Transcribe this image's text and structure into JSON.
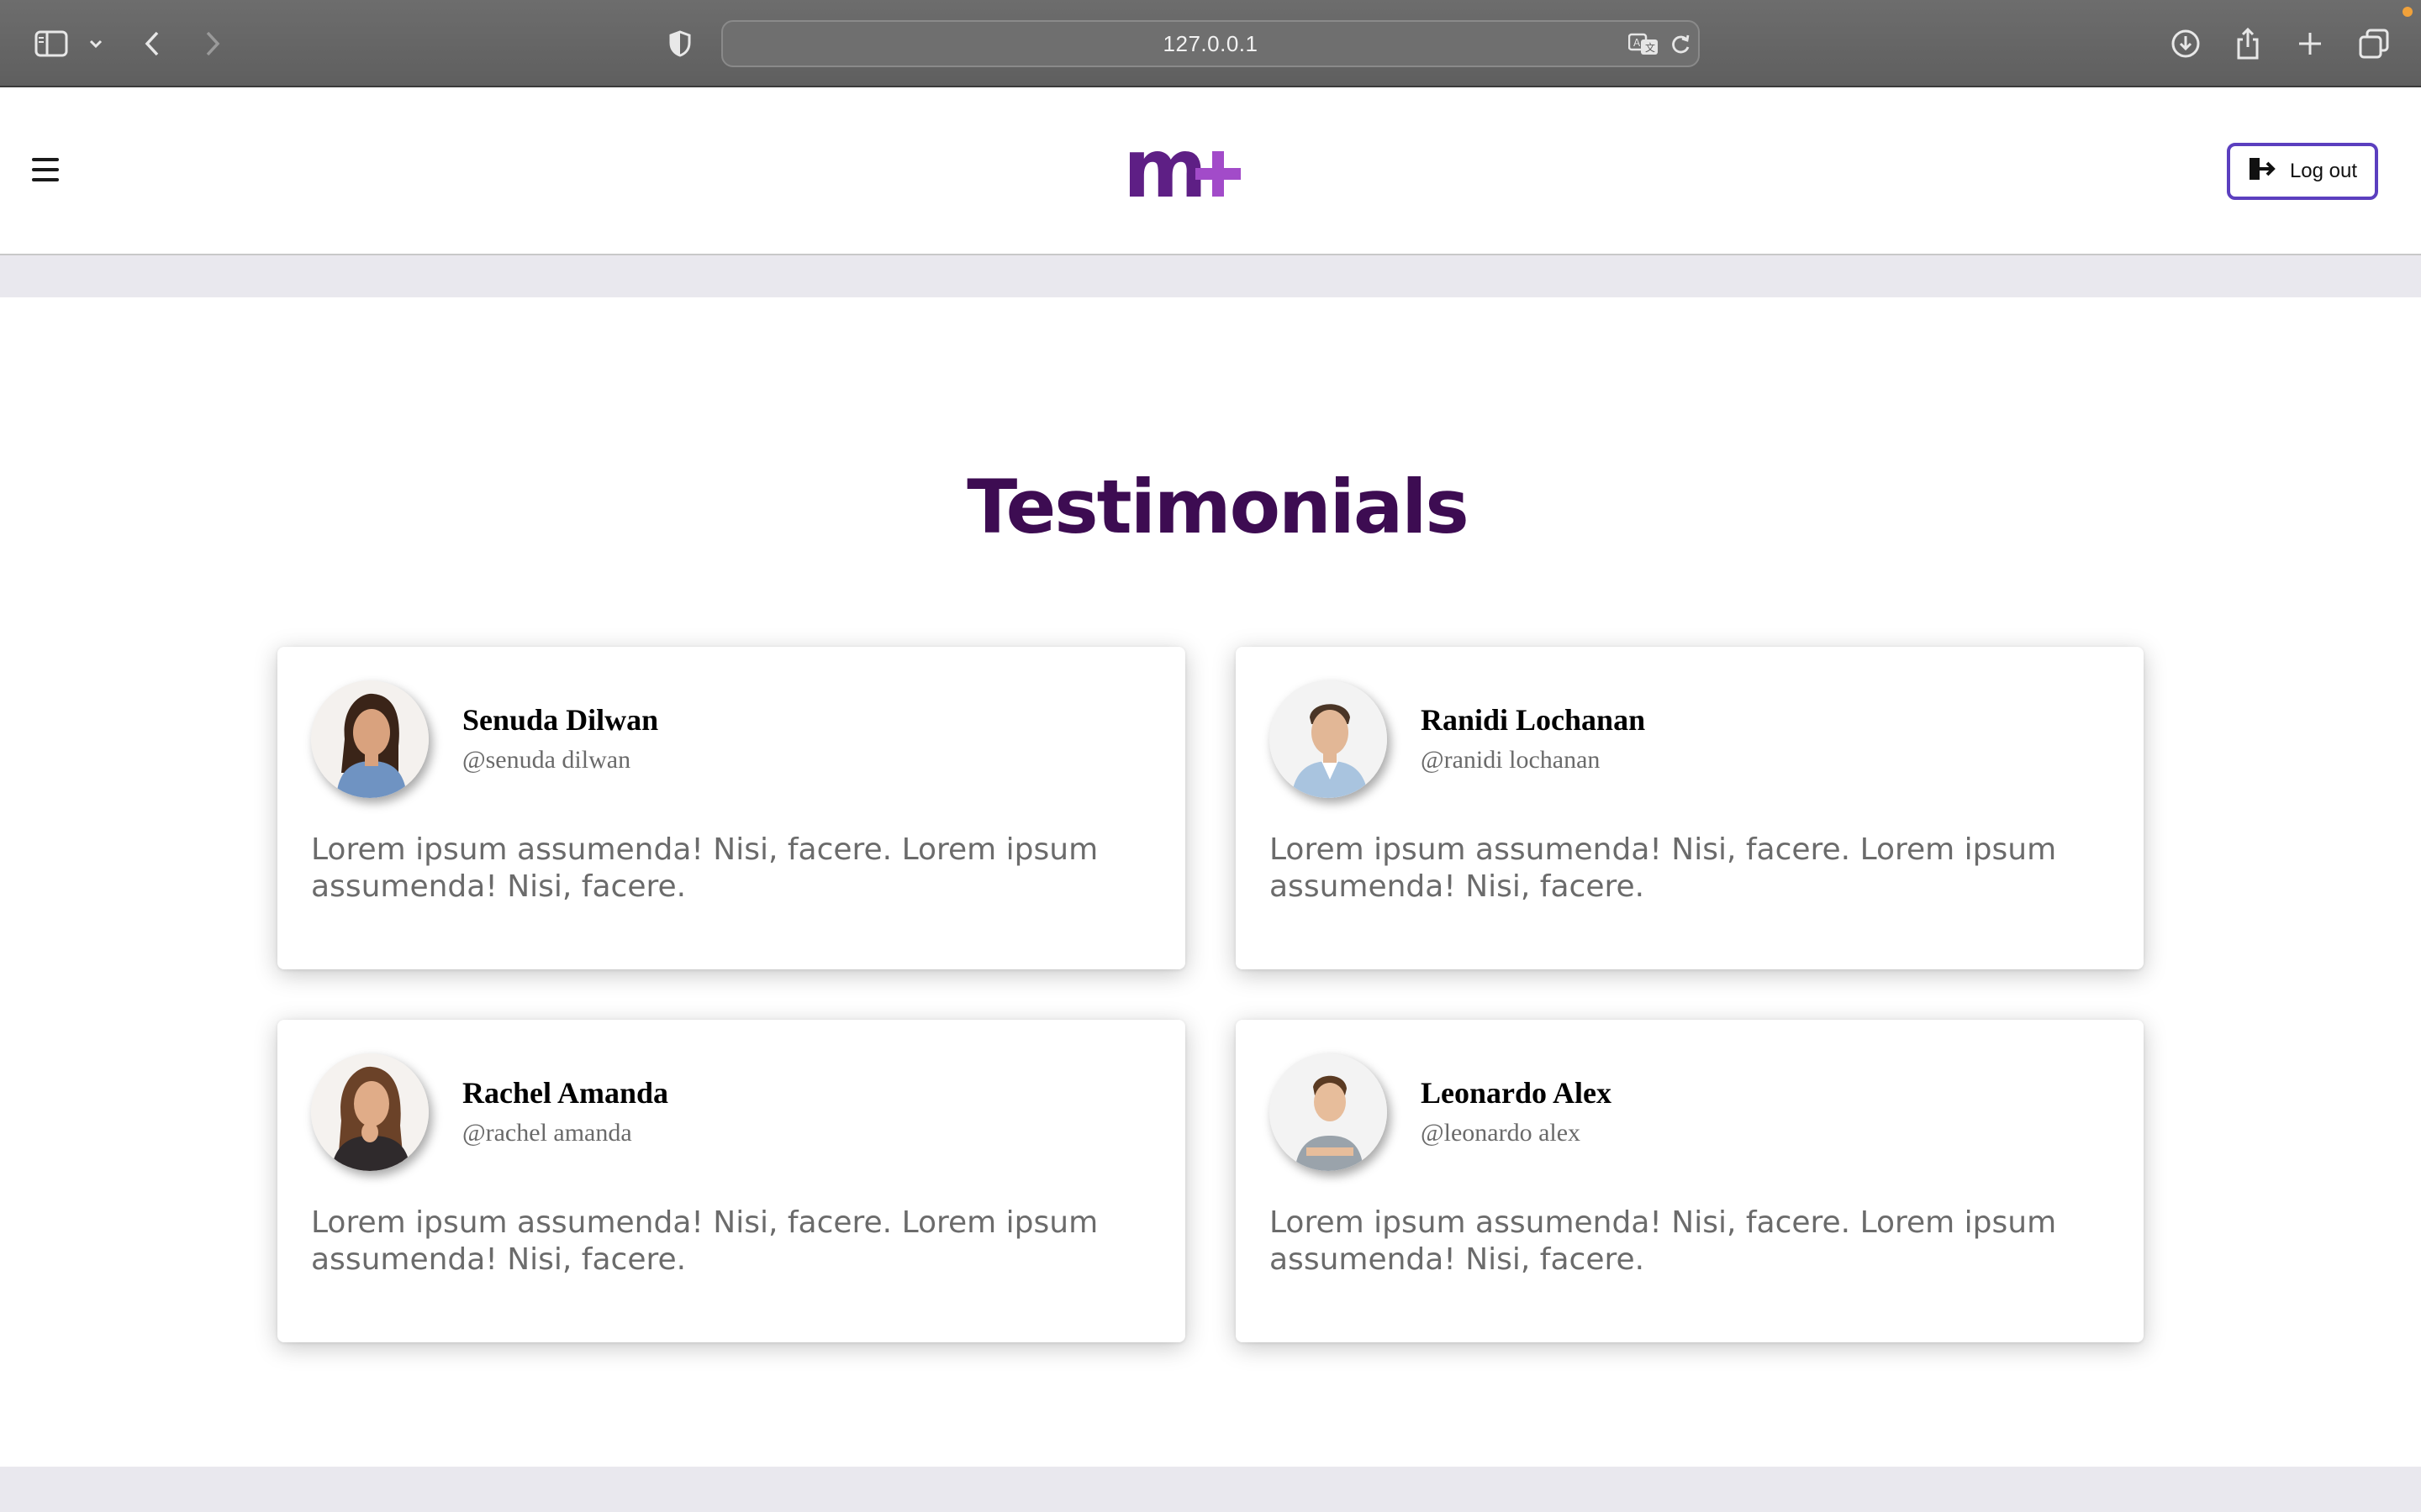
{
  "browser": {
    "url": "127.0.0.1",
    "icons": [
      "sidebar-icon",
      "chevron-down-icon",
      "back-icon",
      "forward-icon",
      "shield-icon",
      "translate-icon",
      "reload-icon",
      "download-icon",
      "share-icon",
      "new-tab-icon",
      "tabs-overview-icon"
    ]
  },
  "header": {
    "logo_text": "m+",
    "logout_label": "Log out",
    "colors": {
      "logo_purple": "#5e1f85",
      "plus_purple": "#a24bc9",
      "button_border": "#5b3fbf"
    }
  },
  "testimonials": {
    "title": "Testimonials",
    "title_color": "#3d0c52",
    "cards": [
      {
        "name": "Senuda Dilwan",
        "handle": "@senuda dilwan",
        "text": "Lorem ipsum assumenda! Nisi, facere. Lorem ipsum assumenda! Nisi, facere."
      },
      {
        "name": "Ranidi Lochanan",
        "handle": "@ranidi lochanan",
        "text": "Lorem ipsum assumenda! Nisi, facere. Lorem ipsum assumenda! Nisi, facere."
      },
      {
        "name": "Rachel Amanda",
        "handle": "@rachel amanda",
        "text": "Lorem ipsum assumenda! Nisi, facere. Lorem ipsum assumenda! Nisi, facere."
      },
      {
        "name": "Leonardo Alex",
        "handle": "@leonardo alex",
        "text": "Lorem ipsum assumenda! Nisi, facere. Lorem ipsum assumenda! Nisi, facere."
      }
    ]
  }
}
